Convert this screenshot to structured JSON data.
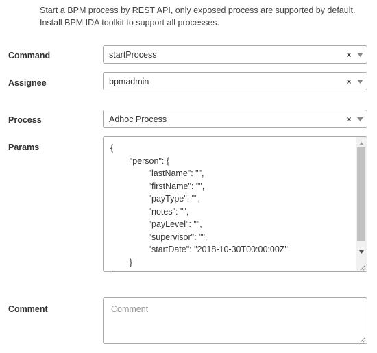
{
  "hint": {
    "line1": "Start a BPM process by REST API, only exposed process are supported by default.",
    "line2": "Install BPM IDA toolkit to support all processes."
  },
  "fields": {
    "command": {
      "label": "Command",
      "value": "startProcess",
      "clear_icon": "×"
    },
    "assignee": {
      "label": "Assignee",
      "value": "bpmadmin",
      "clear_icon": "×"
    },
    "process": {
      "label": "Process",
      "value": "Adhoc Process",
      "clear_icon": "×"
    },
    "params": {
      "label": "Params",
      "lines": [
        "{",
        "        \"person\": {",
        "                \"lastName\": \"\",",
        "                \"firstName\": \"\",",
        "                \"payType\": \"\",",
        "                \"notes\": \"\",",
        "                \"payLevel\": \"\",",
        "                \"supervisor\": \"\",",
        "                \"startDate\": \"2018-10-30T00:00:00Z\"",
        "        }",
        "}"
      ]
    },
    "comment": {
      "label": "Comment",
      "placeholder": "Comment"
    }
  },
  "icons": {
    "clear": "close-icon",
    "dropdown": "chevron-down-icon",
    "scroll_up": "scroll-up-arrow-icon",
    "scroll_down": "scroll-down-arrow-icon",
    "resize": "resize-grip-icon"
  }
}
